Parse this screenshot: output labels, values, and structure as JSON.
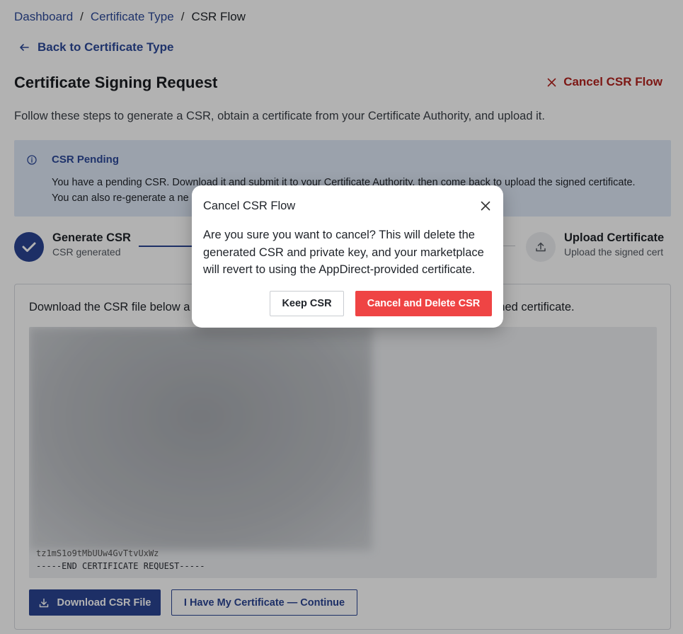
{
  "breadcrumb": {
    "items": [
      "Dashboard",
      "Certificate Type",
      "CSR Flow"
    ],
    "separator": "/"
  },
  "back_link": {
    "label": "Back to Certificate Type",
    "icon": "arrow-left-icon"
  },
  "header": {
    "title": "Certificate Signing Request",
    "cancel_label": "Cancel CSR Flow"
  },
  "intro": "Follow these steps to generate a CSR, obtain a certificate from your Certificate Authority, and upload it.",
  "alert": {
    "title": "CSR Pending",
    "line1": "You have a pending CSR. Download it and submit it to your Certificate Authority, then come back to upload the signed certificate.",
    "line2": "You can also re-generate a ne"
  },
  "stepper": {
    "steps": [
      {
        "title": "Generate CSR",
        "subtitle": "CSR generated",
        "status": "complete"
      },
      {
        "title": "Upload Certificate",
        "subtitle": "Upload the signed cert",
        "status": "pending"
      }
    ]
  },
  "card": {
    "text_left": "Download the CSR file below a",
    "text_right": "igned certificate.",
    "csr_tail_line": "tz1mS1o9tMbUUw4GvTtvUxWz",
    "csr_end_line": "-----END CERTIFICATE REQUEST-----",
    "download_label": "Download CSR File",
    "continue_label": "I Have My Certificate — Continue"
  },
  "modal": {
    "title": "Cancel CSR Flow",
    "body": "Are you sure you want to cancel? This will delete the generated CSR and private key, and your marketplace will revert to using the AppDirect-provided certificate.",
    "keep_label": "Keep CSR",
    "delete_label": "Cancel and Delete CSR"
  },
  "colors": {
    "brand": "#2a4493",
    "link": "#2d4a9a",
    "danger": "#ef4444",
    "danger_text": "#b3231f",
    "alert_bg": "#dfe8f7"
  }
}
